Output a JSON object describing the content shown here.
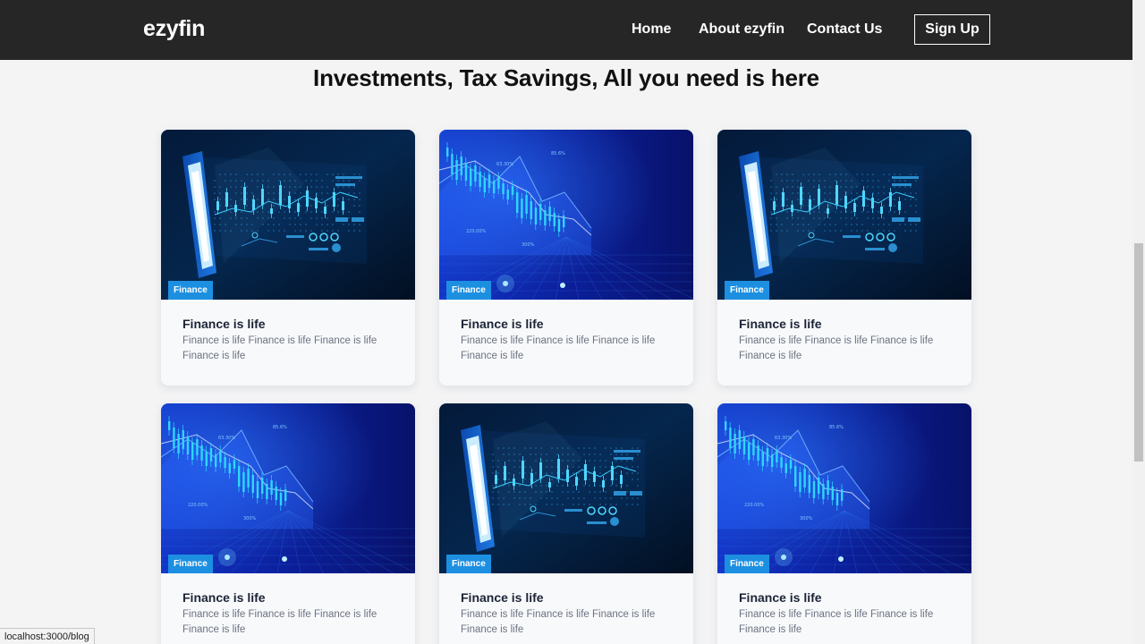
{
  "nav": {
    "brand": "ezyfin",
    "links": [
      "Home",
      "About ezyfin",
      "Contact Us"
    ],
    "signup": "Sign Up"
  },
  "headline": "Investments, Tax Savings, All you need is here",
  "cards": [
    {
      "badge": "Finance",
      "title": "Finance is life",
      "desc": "Finance is life Finance is life Finance is life Finance is life",
      "image": "phone-world-map-chart"
    },
    {
      "badge": "Finance",
      "title": "Finance is life",
      "desc": "Finance is life Finance is life Finance is life Finance is life",
      "image": "blue-candlestick-chart"
    },
    {
      "badge": "Finance",
      "title": "Finance is life",
      "desc": "Finance is life Finance is life Finance is life Finance is life",
      "image": "phone-world-map-chart"
    },
    {
      "badge": "Finance",
      "title": "Finance is life",
      "desc": "Finance is life Finance is life Finance is life Finance is life",
      "image": "blue-candlestick-chart"
    },
    {
      "badge": "Finance",
      "title": "Finance is life",
      "desc": "Finance is life Finance is life Finance is life Finance is life",
      "image": "phone-world-map-chart"
    },
    {
      "badge": "Finance",
      "title": "Finance is life",
      "desc": "Finance is life Finance is life Finance is life Finance is life",
      "image": "blue-candlestick-chart"
    }
  ],
  "status_url": "localhost:3000/blog"
}
